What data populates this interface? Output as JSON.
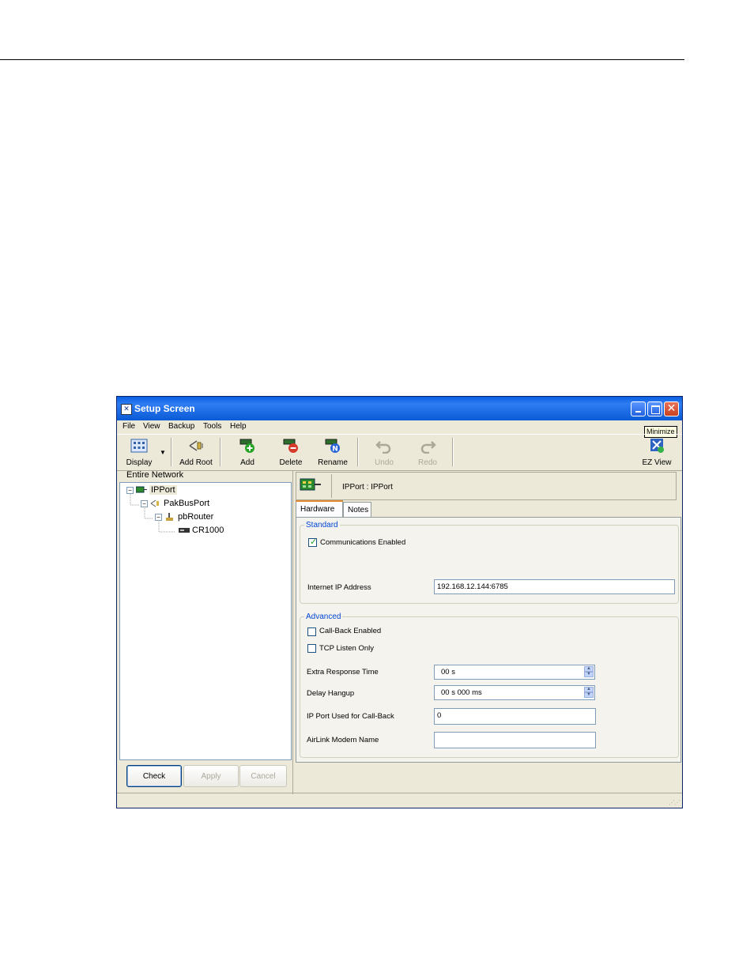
{
  "window": {
    "title": "Setup Screen",
    "tooltip": "Minimize"
  },
  "menu": [
    "File",
    "View",
    "Backup",
    "Tools",
    "Help"
  ],
  "toolbar": {
    "display": "Display",
    "add_root": "Add Root",
    "add": "Add",
    "delete": "Delete",
    "rename": "Rename",
    "undo": "Undo",
    "redo": "Redo",
    "ez_view": "EZ View"
  },
  "network": {
    "label": "Entire Network",
    "nodes": [
      "IPPort",
      "PakBusPort",
      "pbRouter",
      "CR1000"
    ]
  },
  "buttons": {
    "check": "Check",
    "apply": "Apply",
    "cancel": "Cancel"
  },
  "header": {
    "text": "IPPort : IPPort"
  },
  "tabs": [
    "Hardware",
    "Notes"
  ],
  "standard": {
    "legend": "Standard",
    "comms_enabled_label": "Communications Enabled",
    "comms_enabled": true,
    "ip_address_label": "Internet IP Address",
    "ip_address_value": "192.168.12.144:6785"
  },
  "advanced": {
    "legend": "Advanced",
    "callback_enabled_label": "Call-Back Enabled",
    "callback_enabled": false,
    "tcp_listen_label": "TCP Listen Only",
    "tcp_listen": false,
    "extra_response_label": "Extra Response Time",
    "extra_response_value": "00 s",
    "delay_hangup_label": "Delay Hangup",
    "delay_hangup_value": "00 s 000 ms",
    "ip_port_callback_label": "IP Port Used for Call-Back",
    "ip_port_callback_value": "0",
    "airlink_label": "AirLink Modem Name",
    "airlink_value": ""
  },
  "colors": {
    "titlebar": "#0a5fe0",
    "tab_accent": "#e68b2c",
    "legend_blue": "#0046d5"
  }
}
